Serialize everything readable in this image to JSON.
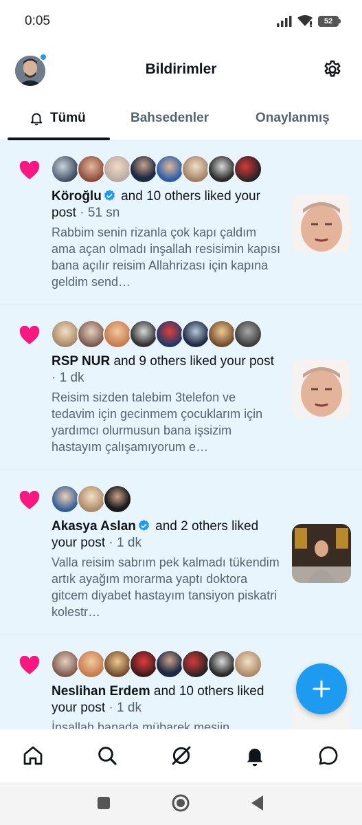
{
  "status_bar": {
    "time": "0:05",
    "battery": "52"
  },
  "header": {
    "title": "Bildirimler"
  },
  "tabs": [
    {
      "label": "Tümü"
    },
    {
      "label": "Bahsedenler"
    },
    {
      "label": "Onaylanmış"
    }
  ],
  "notifications": [
    {
      "actor": "Köroğlu",
      "verified": true,
      "action": "and 10 others liked your post",
      "time": "51 sn",
      "snippet": "Rabbim senin rizanla çok kapı çaldım ama açan olmadı inşallah resisimin kapısı bana açılır reisim Allahrizası için kapına geldim send…"
    },
    {
      "actor": "RSP NUR",
      "verified": false,
      "action": "and 9 others liked your post",
      "time": "1 dk",
      "snippet": "Reisim sizden talebim 3telefon ve tedavim için gecinmem çocuklarım için yardımcı olurmusun bana işsizim hastayım çalışamıyorum e…"
    },
    {
      "actor": "Akasya Aslan",
      "verified": true,
      "action": "and 2 others liked your post",
      "time": "1 dk",
      "snippet": "Valla reisim sabrım pek kalmadı tükendim artık ayağım morarma yaptı doktora gitcem diyabet hastayım tansiyon piskatri kolestr…"
    },
    {
      "actor": "Neslihan Erdem",
      "verified": false,
      "action": "and 10 others liked your post",
      "time": "1 dk",
      "snippet": "İnşallah banada mübarek mesjin…"
    }
  ],
  "colors": {
    "accent": "#1d9bf0",
    "like": "#f91880",
    "unread_bg": "#e8f5fd"
  },
  "icons": [
    "home-icon",
    "search-icon",
    "grok-icon",
    "bell-icon",
    "messages-icon",
    "gear-icon",
    "heart-icon",
    "verified-icon",
    "plus-icon"
  ]
}
